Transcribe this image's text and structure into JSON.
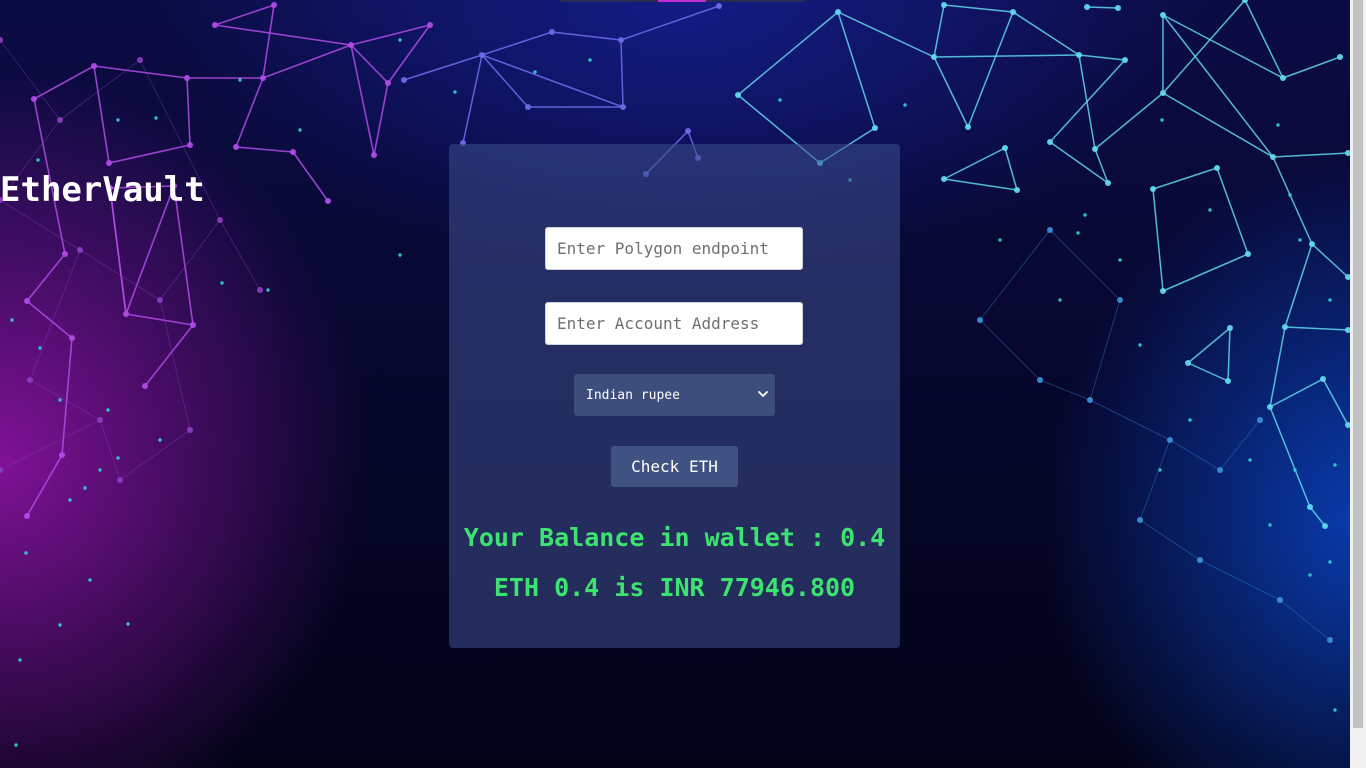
{
  "app": {
    "title": "EtherVault"
  },
  "form": {
    "endpoint_placeholder": "Enter Polygon endpoint",
    "endpoint_value": "",
    "address_placeholder": "Enter Account Address",
    "address_value": "",
    "currency": {
      "selected": "Indian rupee"
    },
    "check_button_label": "Check ETH"
  },
  "results": {
    "balance_text": "Your Balance in wallet : 0.4",
    "conversion_text": "ETH 0.4 is INR 77946.800"
  },
  "icons": {
    "select_arrow": "chevron-down-icon"
  },
  "colors": {
    "accent_green": "#3de371",
    "card_background": "#3e4e8c",
    "button_background": "#3f5282",
    "network_purple": "#b04be8",
    "network_blue": "#6a6ae8",
    "network_cyan": "#5fd8ec",
    "dot_cyan": "#2fd6d6"
  }
}
